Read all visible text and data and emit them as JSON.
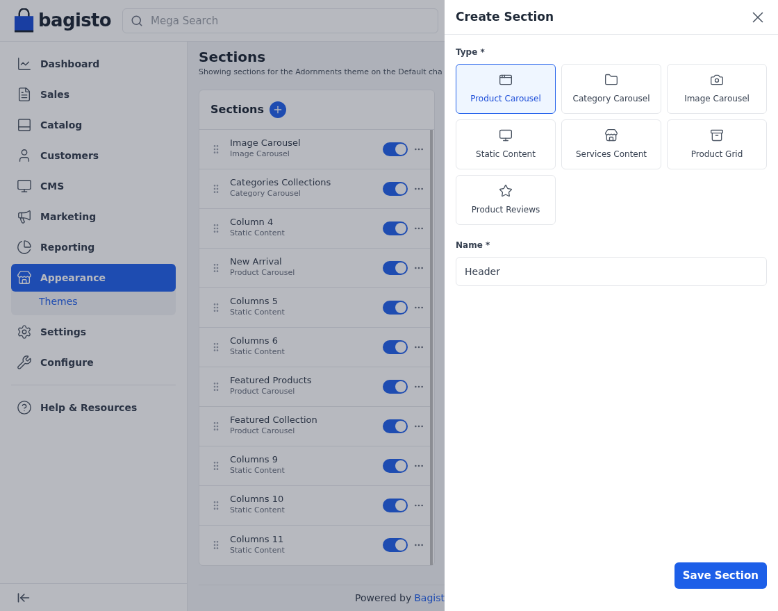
{
  "header": {
    "logo_text": "bagisto",
    "search_placeholder": "Mega Search"
  },
  "sidebar": {
    "items": [
      {
        "label": "Dashboard",
        "selected": false
      },
      {
        "label": "Sales",
        "selected": false
      },
      {
        "label": "Catalog",
        "selected": false
      },
      {
        "label": "Customers",
        "selected": false
      },
      {
        "label": "CMS",
        "selected": false
      },
      {
        "label": "Marketing",
        "selected": false
      },
      {
        "label": "Reporting",
        "selected": false
      },
      {
        "label": "Appearance",
        "selected": true,
        "expanded": true,
        "children": [
          {
            "label": "Themes",
            "selected": true
          }
        ]
      },
      {
        "label": "Settings",
        "selected": false
      },
      {
        "label": "Configure",
        "selected": false
      }
    ],
    "help": "Help & Resources"
  },
  "main": {
    "title": "Sections",
    "description": "Showing sections for the Adornments theme on the Default cha",
    "card_title": "Sections",
    "sections": [
      {
        "name": "Image Carousel",
        "type": "Image Carousel",
        "enabled": true
      },
      {
        "name": "Categories Collections",
        "type": "Category Carousel",
        "enabled": true
      },
      {
        "name": "Column 4",
        "type": "Static Content",
        "enabled": true
      },
      {
        "name": "New Arrival",
        "type": "Product Carousel",
        "enabled": true
      },
      {
        "name": "Columns 5",
        "type": "Static Content",
        "enabled": true
      },
      {
        "name": "Columns 6",
        "type": "Static Content",
        "enabled": true
      },
      {
        "name": "Featured Products",
        "type": "Product Carousel",
        "enabled": true
      },
      {
        "name": "Featured Collection",
        "type": "Product Carousel",
        "enabled": true
      },
      {
        "name": "Columns 9",
        "type": "Static Content",
        "enabled": true
      },
      {
        "name": "Columns 10",
        "type": "Static Content",
        "enabled": true
      },
      {
        "name": "Columns 11",
        "type": "Static Content",
        "enabled": true
      }
    ],
    "footer": {
      "text": "Powered by",
      "link": "Bagist"
    }
  },
  "drawer": {
    "title": "Create Section",
    "type_label": "Type *",
    "types": [
      {
        "label": "Product Carousel",
        "selected": true
      },
      {
        "label": "Category Carousel",
        "selected": false
      },
      {
        "label": "Image Carousel",
        "selected": false
      },
      {
        "label": "Static Content",
        "selected": false
      },
      {
        "label": "Services Content",
        "selected": false
      },
      {
        "label": "Product Grid",
        "selected": false
      },
      {
        "label": "Product Reviews",
        "selected": false
      }
    ],
    "name_label": "Name *",
    "name_value": "Header",
    "save": "Save Section"
  }
}
